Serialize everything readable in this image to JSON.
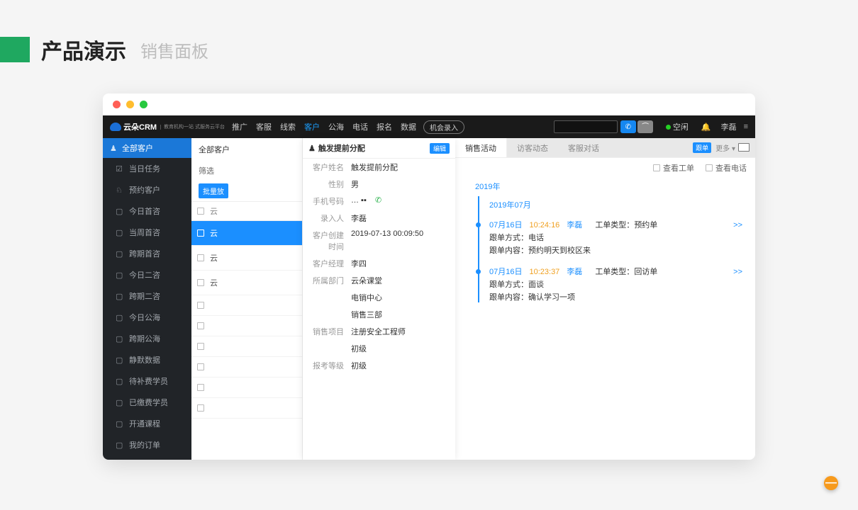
{
  "page": {
    "title": "产品演示",
    "subtitle": "销售面板"
  },
  "topbar": {
    "brand": "云朵CRM",
    "brand_sub": "教育机构一站\n式服务云平台",
    "nav": [
      "推广",
      "客服",
      "线索",
      "客户",
      "公海",
      "电话",
      "报名",
      "数据"
    ],
    "nav_active_index": 3,
    "opportunity_btn": "机会录入",
    "status": "空闲",
    "user": "李磊"
  },
  "sidebar": {
    "header": "全部客户",
    "items": [
      "当日任务",
      "预约客户",
      "今日首咨",
      "当周首咨",
      "跨期首咨",
      "今日二咨",
      "跨期二咨",
      "今日公海",
      "跨期公海",
      "静默数据",
      "待补费学员",
      "已缴费学员",
      "开通课程",
      "我的订单"
    ]
  },
  "mid": {
    "title": "全部客户",
    "filter_label": "筛选",
    "bulk_btn": "批量放",
    "col_name": "云",
    "rows": [
      "云",
      "云",
      "云",
      "",
      "",
      "",
      "",
      "",
      ""
    ]
  },
  "detail": {
    "title": "触发提前分配",
    "edit": "编辑",
    "fields": [
      {
        "k": "客户姓名",
        "v": "触发提前分配"
      },
      {
        "k": "性别",
        "v": "男"
      },
      {
        "k": "手机号码",
        "v": "…  ▪▪"
      },
      {
        "k": "录入人",
        "v": "李磊"
      },
      {
        "k": "客户创建时间",
        "v": "2019-07-13 00:09:50"
      },
      {
        "k": "客户经理",
        "v": "李四"
      },
      {
        "k": "所属部门",
        "v": "云朵课堂"
      },
      {
        "k": "",
        "v": "电销中心"
      },
      {
        "k": "",
        "v": "销售三部"
      },
      {
        "k": "销售项目",
        "v": "注册安全工程师"
      },
      {
        "k": "",
        "v": "初级"
      },
      {
        "k": "报考等级",
        "v": "初级"
      }
    ]
  },
  "activity": {
    "tabs": [
      "销售活动",
      "访客动态",
      "客服对话"
    ],
    "follow_badge": "跟单",
    "more": "更多 ▾",
    "filters": {
      "view_ticket": "查看工单",
      "view_call": "查看电话"
    },
    "year": "2019年",
    "month": "2019年07月",
    "entries": [
      {
        "date": "07月16日",
        "time": "10:24:16",
        "user": "李磊",
        "type_label": "工单类型：",
        "type_value": "预约单",
        "method_label": "跟单方式：",
        "method_value": "电话",
        "content_label": "跟单内容：",
        "content_value": "预约明天到校区来",
        "more": ">>"
      },
      {
        "date": "07月16日",
        "time": "10:23:37",
        "user": "李磊",
        "type_label": "工单类型：",
        "type_value": "回访单",
        "method_label": "跟单方式：",
        "method_value": "面谈",
        "content_label": "跟单内容：",
        "content_value": "确认学习一项",
        "more": ">>"
      }
    ]
  },
  "fab": "—"
}
